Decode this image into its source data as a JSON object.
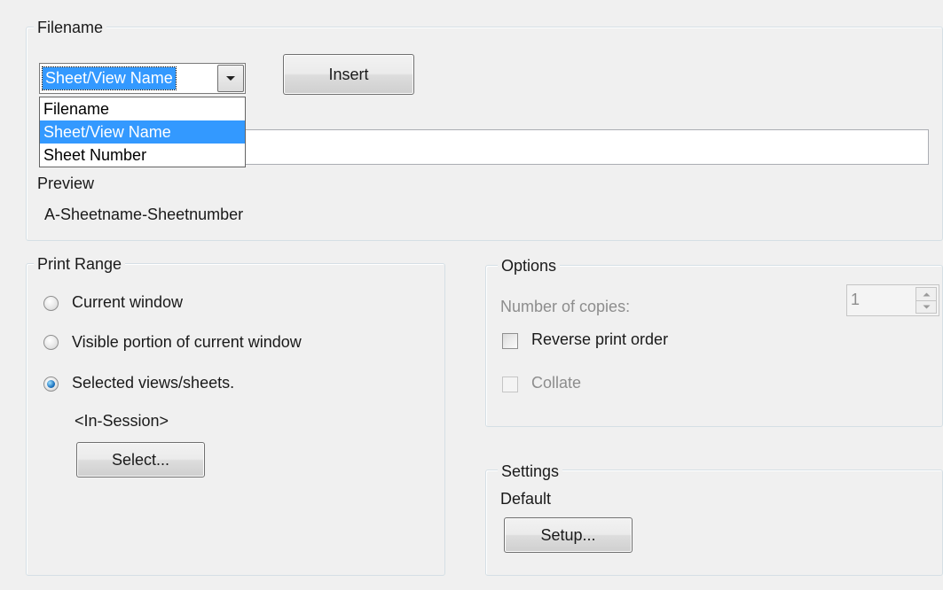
{
  "filename_group": {
    "title": "Filename",
    "combo_value": "Sheet/View Name",
    "dropdown_options": [
      "Filename",
      "Sheet/View Name",
      "Sheet Number"
    ],
    "selected_index": 1,
    "insert_label": "Insert",
    "filename_value": "",
    "preview_label": "Preview",
    "preview_value": "A-Sheetname-Sheetnumber"
  },
  "print_range": {
    "title": "Print Range",
    "options": [
      "Current window",
      "Visible portion of current window",
      "Selected views/sheets."
    ],
    "selected_index": 2,
    "session_label": "<In-Session>",
    "select_button": "Select..."
  },
  "options": {
    "title": "Options",
    "copies_label": "Number of copies:",
    "copies_value": "1",
    "reverse_label": "Reverse print order",
    "collate_label": "Collate"
  },
  "settings": {
    "title": "Settings",
    "value": "Default",
    "setup_button": "Setup..."
  },
  "icons": {
    "combo_arrow": "chevron-down-icon",
    "spin_up": "arrow-up-icon",
    "spin_down": "arrow-down-icon"
  },
  "colors": {
    "selection": "#3399ff",
    "background": "#f0f0f0"
  }
}
